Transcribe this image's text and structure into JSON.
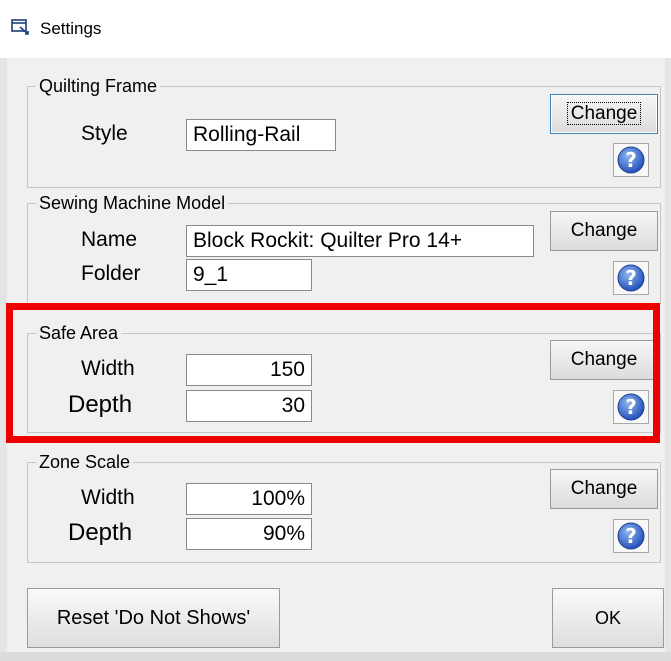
{
  "window": {
    "title": "Settings",
    "icon": "settings-window-icon"
  },
  "quilting_frame": {
    "title": "Quilting Frame",
    "style_label": "Style",
    "style_value": "Rolling-Rail",
    "change_label": "Change"
  },
  "sewing_machine": {
    "title": "Sewing Machine Model",
    "name_label": "Name",
    "name_value": "Block Rockit: Quilter Pro 14+",
    "folder_label": "Folder",
    "folder_value": "9_1",
    "change_label": "Change"
  },
  "safe_area": {
    "title": "Safe Area",
    "width_label": "Width",
    "width_value": "150",
    "depth_label": "Depth",
    "depth_value": "30",
    "change_label": "Change"
  },
  "zone_scale": {
    "title": "Zone Scale",
    "width_label": "Width",
    "width_value": "100%",
    "depth_label": "Depth",
    "depth_value": "90%",
    "change_label": "Change"
  },
  "footer": {
    "reset_label": "Reset 'Do Not Shows'",
    "ok_label": "OK"
  },
  "colors": {
    "highlight": "#ee0000",
    "help_icon": "#2a62c4"
  }
}
